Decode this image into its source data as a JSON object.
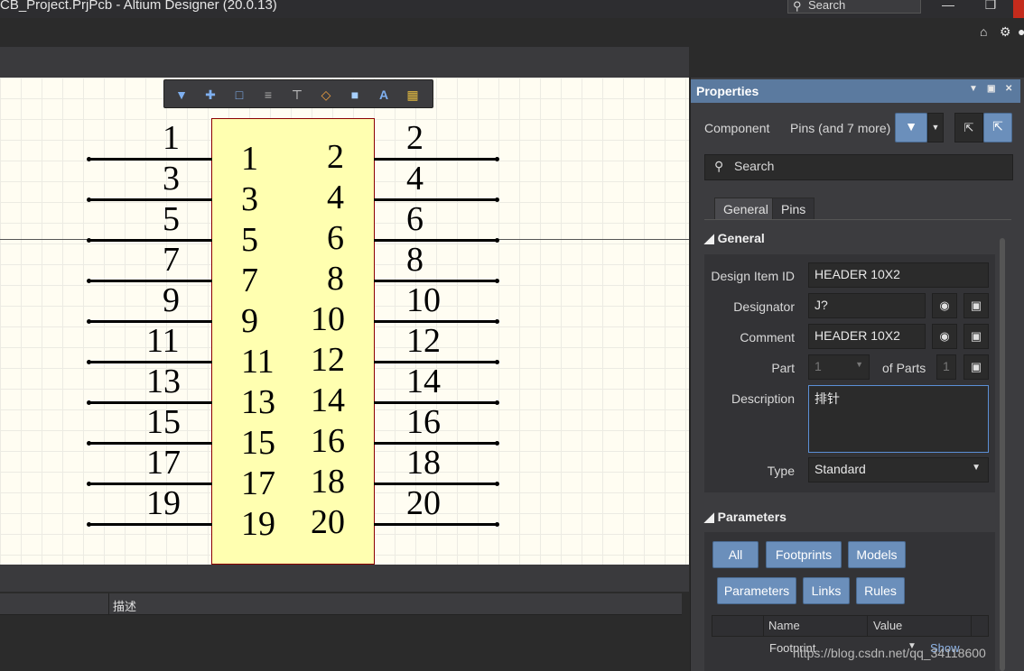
{
  "window": {
    "title": "CB_Project.PrjPcb - Altium Designer (20.0.13)",
    "search_placeholder": "Search"
  },
  "toolbar_icons": [
    "filter-icon",
    "add-icon",
    "select-rect-icon",
    "align-icon",
    "place-pin-icon",
    "fill-icon",
    "rectangle-icon",
    "text-icon",
    "component-icon"
  ],
  "schematic": {
    "left_pin_numbers": [
      "1",
      "3",
      "5",
      "7",
      "9",
      "11",
      "13",
      "15",
      "17",
      "19"
    ],
    "right_pin_numbers": [
      "2",
      "4",
      "6",
      "8",
      "10",
      "12",
      "14",
      "16",
      "18",
      "20"
    ],
    "body_left_labels": [
      "1",
      "3",
      "5",
      "7",
      "9",
      "11",
      "13",
      "15",
      "17",
      "19"
    ],
    "body_right_labels": [
      "2",
      "4",
      "6",
      "8",
      "10",
      "12",
      "14",
      "16",
      "18",
      "20"
    ],
    "body_color": "#ffffb0",
    "border_color": "#8b0000"
  },
  "bottom_panel": {
    "column_header": "描述"
  },
  "properties": {
    "title": "Properties",
    "filter_kind": "Component",
    "filter_scope": "Pins (and 7 more)",
    "search_placeholder": "Search",
    "tabs": [
      "General",
      "Pins"
    ],
    "general": {
      "section_title": "General",
      "design_item_id_label": "Design Item ID",
      "design_item_id_value": "HEADER 10X2",
      "designator_label": "Designator",
      "designator_value": "J?",
      "comment_label": "Comment",
      "comment_value": "HEADER 10X2",
      "part_label": "Part",
      "part_value": "1",
      "of_parts_label": "of Parts",
      "of_parts_value": "1",
      "description_label": "Description",
      "description_value": "排针",
      "type_label": "Type",
      "type_value": "Standard"
    },
    "parameters": {
      "section_title": "Parameters",
      "buttons": [
        "All",
        "Footprints",
        "Models",
        "Parameters",
        "Links",
        "Rules"
      ],
      "columns": [
        "Name",
        "Value"
      ],
      "row_name": "Footprint",
      "row_value": "Show"
    }
  },
  "watermark": "https://blog.csdn.net/qq_34118600"
}
